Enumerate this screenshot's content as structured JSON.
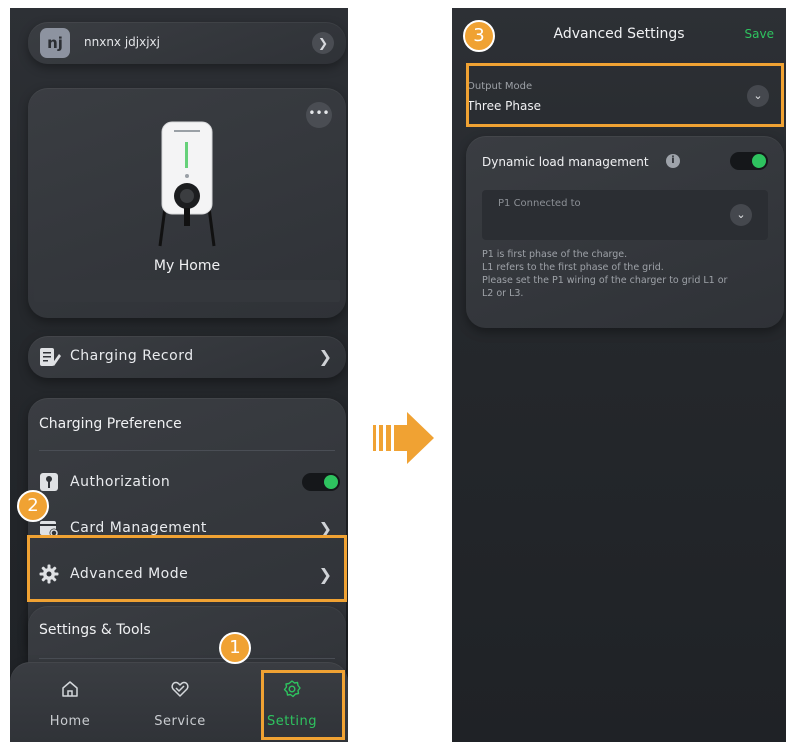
{
  "colors": {
    "accent": "#f0a233",
    "toggle_on": "#2ec35f",
    "background": "#2b2e33"
  },
  "left_screen": {
    "user": {
      "avatar_initials": "nj",
      "name": "nnxnx jdjxjxj"
    },
    "home": {
      "name": "My Home"
    },
    "charging_record": {
      "label": "Charging Record"
    },
    "charging_preference": {
      "title": "Charging Preference",
      "items": [
        {
          "label": "Authorization",
          "icon": "authorization-key-icon",
          "control": "toggle",
          "enabled": true
        },
        {
          "label": "Card Management",
          "icon": "card-settings-icon",
          "control": "chevron"
        },
        {
          "label": "Advanced Mode",
          "icon": "gear-icon",
          "control": "chevron"
        }
      ]
    },
    "settings_tools": {
      "title": "Settings & Tools"
    },
    "tabs": [
      {
        "label": "Home",
        "icon": "home-icon",
        "active": false
      },
      {
        "label": "Service",
        "icon": "service-icon",
        "active": false
      },
      {
        "label": "Setting",
        "icon": "settings-gear-icon",
        "active": true
      }
    ]
  },
  "right_screen": {
    "title": "Advanced Settings",
    "save_label": "Save",
    "output_mode": {
      "label": "Output Mode",
      "value": "Three Phase"
    },
    "dynamic_load": {
      "title": "Dynamic load management",
      "enabled": true,
      "p1_placeholder": "P1 Connected to",
      "description": [
        "P1 is first phase of the charge.",
        "L1 refers to the first phase of the grid.",
        "Please set the P1 wiring of the charger to grid L1 or",
        "L2 or L3."
      ]
    }
  },
  "steps": [
    "1",
    "2",
    "3"
  ]
}
